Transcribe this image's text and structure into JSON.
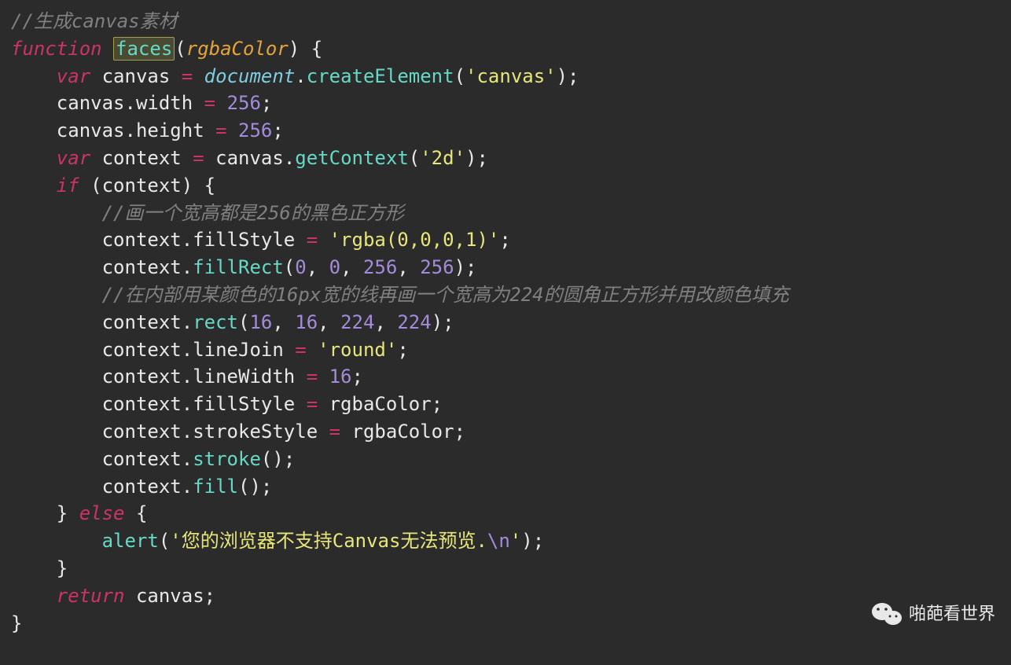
{
  "code": {
    "l1": {
      "comment": "//生成canvas素材"
    },
    "l2": {
      "kw_function": "function",
      "fnname": "faces",
      "param": "rgbaColor",
      "brace": " {"
    },
    "l3": {
      "kw_var": "var",
      "v_canvas": "canvas",
      "eq": " = ",
      "obj_document": "document",
      "dot": ".",
      "m_createElement": "createElement",
      "lp": "(",
      "str": "'canvas'",
      "rp_sc": ");"
    },
    "l4": {
      "lhs_canvas": "canvas",
      "dot": ".",
      "prop": "width",
      "eq": " = ",
      "num": "256",
      "sc": ";"
    },
    "l5": {
      "lhs_canvas": "canvas",
      "dot": ".",
      "prop": "height",
      "eq": " = ",
      "num": "256",
      "sc": ";"
    },
    "l6": {
      "kw_var": "var",
      "v_context": "context",
      "eq": " = ",
      "obj_canvas": "canvas",
      "dot": ".",
      "m_getContext": "getContext",
      "lp": "(",
      "str": "'2d'",
      "rp_sc": ");"
    },
    "l7": {
      "kw_if": "if",
      "lp": " (",
      "var": "context",
      "rp": ") ",
      "brace": "{"
    },
    "l8": {
      "comment": "//画一个宽高都是256的黑色正方形"
    },
    "l9": {
      "obj": "context",
      "dot": ".",
      "prop": "fillStyle",
      "eq": " = ",
      "str": "'rgba(0,0,0,1)'",
      "sc": ";"
    },
    "l10": {
      "obj": "context",
      "dot": ".",
      "m": "fillRect",
      "lp": "(",
      "n1": "0",
      "c1": ", ",
      "n2": "0",
      "c2": ", ",
      "n3": "256",
      "c3": ", ",
      "n4": "256",
      "rp_sc": ");"
    },
    "l11": {
      "comment": "//在内部用某颜色的16px宽的线再画一个宽高为224的圆角正方形并用改颜色填充"
    },
    "l12": {
      "obj": "context",
      "dot": ".",
      "m": "rect",
      "lp": "(",
      "n1": "16",
      "c1": ", ",
      "n2": "16",
      "c2": ", ",
      "n3": "224",
      "c3": ", ",
      "n4": "224",
      "rp_sc": ");"
    },
    "l13": {
      "obj": "context",
      "dot": ".",
      "prop": "lineJoin",
      "eq": " = ",
      "str": "'round'",
      "sc": ";"
    },
    "l14": {
      "obj": "context",
      "dot": ".",
      "prop": "lineWidth",
      "eq": " = ",
      "num": "16",
      "sc": ";"
    },
    "l15": {
      "obj": "context",
      "dot": ".",
      "prop": "fillStyle",
      "eq": " = ",
      "val": "rgbaColor",
      "sc": ";"
    },
    "l16": {
      "obj": "context",
      "dot": ".",
      "prop": "strokeStyle",
      "eq": " = ",
      "val": "rgbaColor",
      "sc": ";"
    },
    "l17": {
      "obj": "context",
      "dot": ".",
      "m": "stroke",
      "args": "()",
      "sc": ";"
    },
    "l18": {
      "obj": "context",
      "dot": ".",
      "m": "fill",
      "args": "()",
      "sc": ";"
    },
    "l19": {
      "brace_close": "}",
      "kw_else": " else ",
      "brace_open": "{"
    },
    "l20": {
      "fn_alert": "alert",
      "lp": "(",
      "str_a": "'您的浏览器不支持Canvas无法预览.",
      "esc": "\\n",
      "str_b": "'",
      "rp_sc": ");"
    },
    "l21": {
      "brace": "}"
    },
    "l22": {
      "kw_return": "return",
      "sp": " ",
      "val": "canvas",
      "sc": ";"
    },
    "l23": {
      "brace": "}"
    }
  },
  "watermark": {
    "text": "啪葩看世界"
  }
}
